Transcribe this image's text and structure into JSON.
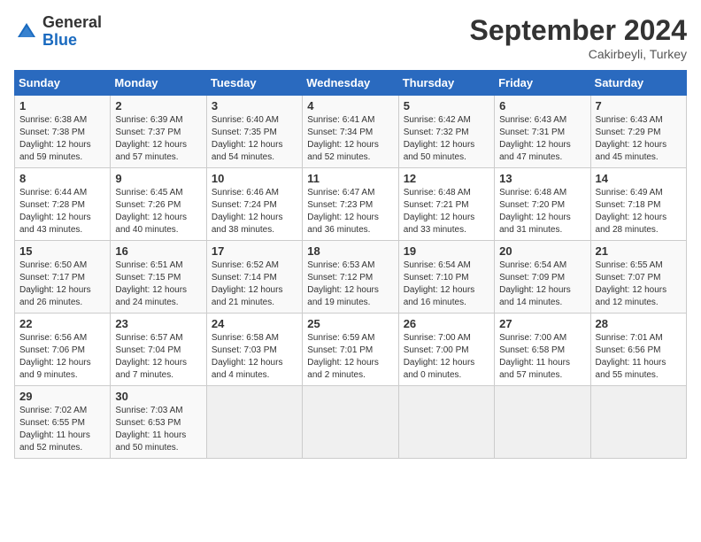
{
  "header": {
    "logo_general": "General",
    "logo_blue": "Blue",
    "month_title": "September 2024",
    "location": "Cakirbeyli, Turkey"
  },
  "calendar": {
    "days_of_week": [
      "Sunday",
      "Monday",
      "Tuesday",
      "Wednesday",
      "Thursday",
      "Friday",
      "Saturday"
    ],
    "weeks": [
      [
        {
          "day": "",
          "empty": true
        },
        {
          "day": "",
          "empty": true
        },
        {
          "day": "",
          "empty": true
        },
        {
          "day": "",
          "empty": true
        },
        {
          "day": "5",
          "sunrise": "6:42 AM",
          "sunset": "7:32 PM",
          "daylight": "12 hours and 50 minutes."
        },
        {
          "day": "6",
          "sunrise": "6:43 AM",
          "sunset": "7:31 PM",
          "daylight": "12 hours and 47 minutes."
        },
        {
          "day": "7",
          "sunrise": "6:43 AM",
          "sunset": "7:29 PM",
          "daylight": "12 hours and 45 minutes."
        }
      ],
      [
        {
          "day": "1",
          "sunrise": "6:38 AM",
          "sunset": "7:38 PM",
          "daylight": "12 hours and 59 minutes."
        },
        {
          "day": "2",
          "sunrise": "6:39 AM",
          "sunset": "7:37 PM",
          "daylight": "12 hours and 57 minutes."
        },
        {
          "day": "3",
          "sunrise": "6:40 AM",
          "sunset": "7:35 PM",
          "daylight": "12 hours and 54 minutes."
        },
        {
          "day": "4",
          "sunrise": "6:41 AM",
          "sunset": "7:34 PM",
          "daylight": "12 hours and 52 minutes."
        },
        {
          "day": "5",
          "sunrise": "6:42 AM",
          "sunset": "7:32 PM",
          "daylight": "12 hours and 50 minutes."
        },
        {
          "day": "6",
          "sunrise": "6:43 AM",
          "sunset": "7:31 PM",
          "daylight": "12 hours and 47 minutes."
        },
        {
          "day": "7",
          "sunrise": "6:43 AM",
          "sunset": "7:29 PM",
          "daylight": "12 hours and 45 minutes."
        }
      ],
      [
        {
          "day": "8",
          "sunrise": "6:44 AM",
          "sunset": "7:28 PM",
          "daylight": "12 hours and 43 minutes."
        },
        {
          "day": "9",
          "sunrise": "6:45 AM",
          "sunset": "7:26 PM",
          "daylight": "12 hours and 40 minutes."
        },
        {
          "day": "10",
          "sunrise": "6:46 AM",
          "sunset": "7:24 PM",
          "daylight": "12 hours and 38 minutes."
        },
        {
          "day": "11",
          "sunrise": "6:47 AM",
          "sunset": "7:23 PM",
          "daylight": "12 hours and 36 minutes."
        },
        {
          "day": "12",
          "sunrise": "6:48 AM",
          "sunset": "7:21 PM",
          "daylight": "12 hours and 33 minutes."
        },
        {
          "day": "13",
          "sunrise": "6:48 AM",
          "sunset": "7:20 PM",
          "daylight": "12 hours and 31 minutes."
        },
        {
          "day": "14",
          "sunrise": "6:49 AM",
          "sunset": "7:18 PM",
          "daylight": "12 hours and 28 minutes."
        }
      ],
      [
        {
          "day": "15",
          "sunrise": "6:50 AM",
          "sunset": "7:17 PM",
          "daylight": "12 hours and 26 minutes."
        },
        {
          "day": "16",
          "sunrise": "6:51 AM",
          "sunset": "7:15 PM",
          "daylight": "12 hours and 24 minutes."
        },
        {
          "day": "17",
          "sunrise": "6:52 AM",
          "sunset": "7:14 PM",
          "daylight": "12 hours and 21 minutes."
        },
        {
          "day": "18",
          "sunrise": "6:53 AM",
          "sunset": "7:12 PM",
          "daylight": "12 hours and 19 minutes."
        },
        {
          "day": "19",
          "sunrise": "6:54 AM",
          "sunset": "7:10 PM",
          "daylight": "12 hours and 16 minutes."
        },
        {
          "day": "20",
          "sunrise": "6:54 AM",
          "sunset": "7:09 PM",
          "daylight": "12 hours and 14 minutes."
        },
        {
          "day": "21",
          "sunrise": "6:55 AM",
          "sunset": "7:07 PM",
          "daylight": "12 hours and 12 minutes."
        }
      ],
      [
        {
          "day": "22",
          "sunrise": "6:56 AM",
          "sunset": "7:06 PM",
          "daylight": "12 hours and 9 minutes."
        },
        {
          "day": "23",
          "sunrise": "6:57 AM",
          "sunset": "7:04 PM",
          "daylight": "12 hours and 7 minutes."
        },
        {
          "day": "24",
          "sunrise": "6:58 AM",
          "sunset": "7:03 PM",
          "daylight": "12 hours and 4 minutes."
        },
        {
          "day": "25",
          "sunrise": "6:59 AM",
          "sunset": "7:01 PM",
          "daylight": "12 hours and 2 minutes."
        },
        {
          "day": "26",
          "sunrise": "7:00 AM",
          "sunset": "7:00 PM",
          "daylight": "12 hours and 0 minutes."
        },
        {
          "day": "27",
          "sunrise": "7:00 AM",
          "sunset": "6:58 PM",
          "daylight": "11 hours and 57 minutes."
        },
        {
          "day": "28",
          "sunrise": "7:01 AM",
          "sunset": "6:56 PM",
          "daylight": "11 hours and 55 minutes."
        }
      ],
      [
        {
          "day": "29",
          "sunrise": "7:02 AM",
          "sunset": "6:55 PM",
          "daylight": "11 hours and 52 minutes."
        },
        {
          "day": "30",
          "sunrise": "7:03 AM",
          "sunset": "6:53 PM",
          "daylight": "11 hours and 50 minutes."
        },
        {
          "day": "",
          "empty": true
        },
        {
          "day": "",
          "empty": true
        },
        {
          "day": "",
          "empty": true
        },
        {
          "day": "",
          "empty": true
        },
        {
          "day": "",
          "empty": true
        }
      ]
    ]
  },
  "labels": {
    "sunrise": "Sunrise:",
    "sunset": "Sunset:",
    "daylight": "Daylight:"
  }
}
